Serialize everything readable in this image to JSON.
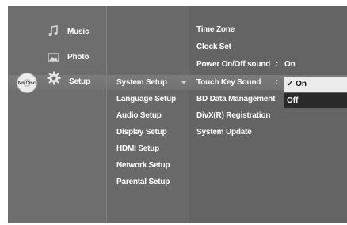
{
  "nodisc": {
    "label": "No Disc"
  },
  "main_menu": [
    {
      "label": "Music",
      "icon": "music-note-icon"
    },
    {
      "label": "Photo",
      "icon": "photo-icon"
    },
    {
      "label": "Setup",
      "icon": "gear-icon",
      "selected": true
    }
  ],
  "setup_menu": [
    "System Setup",
    "Language Setup",
    "Audio Setup",
    "Display Setup",
    "HDMI Setup",
    "Network Setup",
    "Parental Setup"
  ],
  "system_items": [
    {
      "label": "Time Zone",
      "value": ""
    },
    {
      "label": "Clock Set",
      "value": ""
    },
    {
      "label": "Power On/Off sound",
      "value": "On"
    },
    {
      "label": "Touch Key Sound",
      "value": ""
    },
    {
      "label": "BD Data Management",
      "value": ""
    },
    {
      "label": "DivX(R) Registration",
      "value": ""
    },
    {
      "label": "System Update",
      "value": ""
    }
  ],
  "colon": ":",
  "popup": {
    "on": "✓ On",
    "off": "Off"
  }
}
